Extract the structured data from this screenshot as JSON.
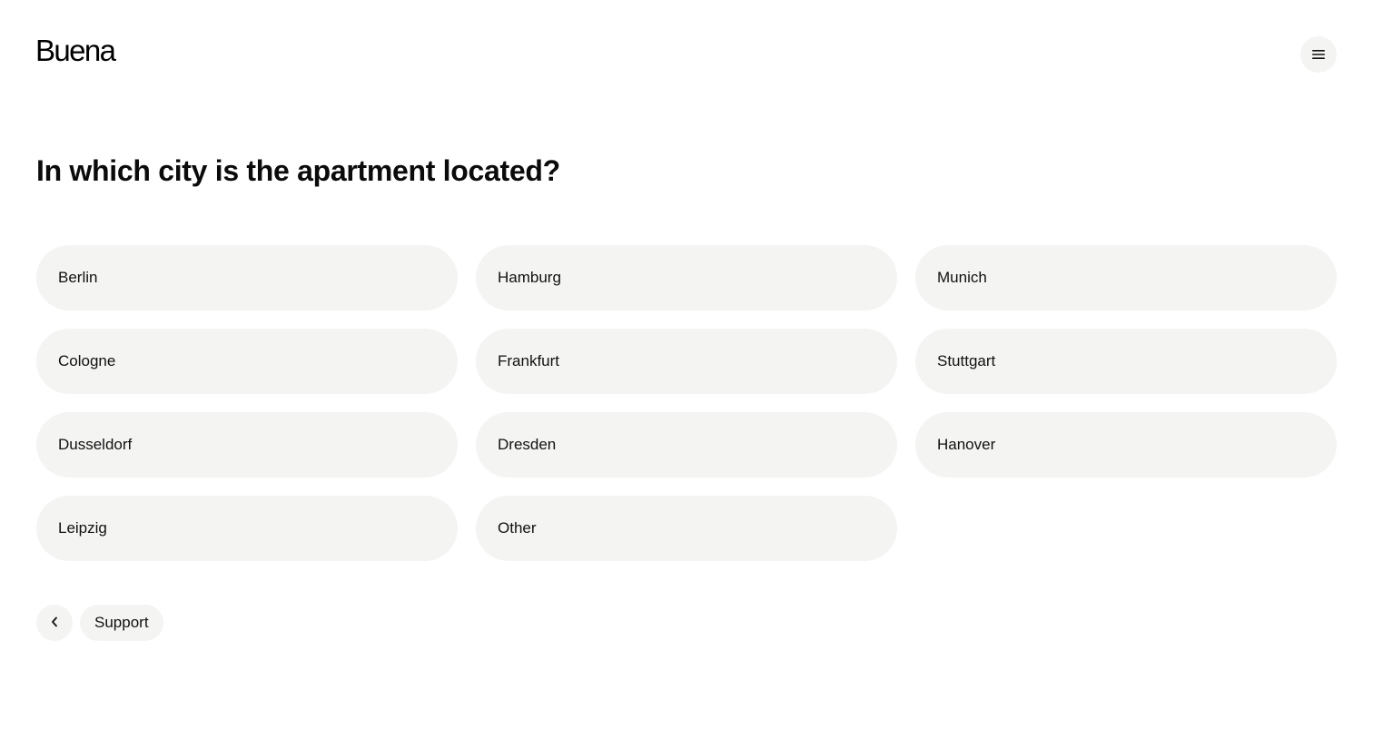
{
  "header": {
    "logo_text": "Buena",
    "menu_icon": "hamburger-menu-icon"
  },
  "question": {
    "title": "In which city is the apartment located?"
  },
  "options": [
    {
      "label": "Berlin"
    },
    {
      "label": "Hamburg"
    },
    {
      "label": "Munich"
    },
    {
      "label": "Cologne"
    },
    {
      "label": "Frankfurt"
    },
    {
      "label": "Stuttgart"
    },
    {
      "label": "Dusseldorf"
    },
    {
      "label": "Dresden"
    },
    {
      "label": "Hanover"
    },
    {
      "label": "Leipzig"
    },
    {
      "label": "Other"
    }
  ],
  "footer": {
    "back_icon": "chevron-left-icon",
    "support_label": "Support"
  },
  "colors": {
    "background": "#ffffff",
    "option_background": "#f4f4f3",
    "text": "#111111"
  }
}
